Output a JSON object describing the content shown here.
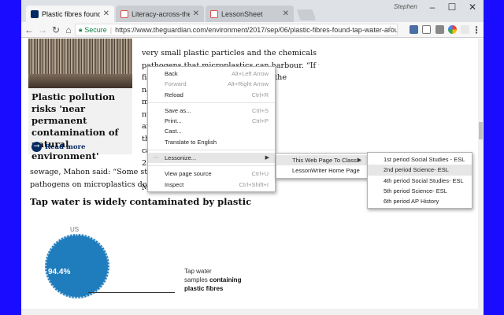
{
  "tabs": [
    {
      "label": "Plastic fibres found in tap",
      "active": true,
      "favicon_color": "#052962"
    },
    {
      "label": "Literacy-across-the-curric",
      "active": false,
      "favicon_color": "#d9534f"
    },
    {
      "label": "LessonSheet",
      "active": false,
      "favicon_color": "#d9534f"
    }
  ],
  "profile_name": "Stephen",
  "omnibox": {
    "secure_label": "Secure",
    "url": "https://www.theguardian.com/environment/2017/sep/06/plastic-fibres-found-tap-water-arou..."
  },
  "card": {
    "title": "Plastic pollution risks 'near permanent contamination of natural environment'",
    "read_more": "Read more"
  },
  "article_lines": [
    "very small plastic particles and the chemicals or",
    "pathogens that microplastics can harbour. “If the",
    "fibres are there, it is possible that the",
    "na                                                    n't",
    "m                                                   the",
    "nu                                                 trate a cell",
    "an                                                 ans, and",
    "th                                                lyses",
    "ca                                             ons in size,",
    "2",
    "",
    "M"
  ],
  "wide_lines": [
    "sewage, Mahon said: “Some studi",
    "pathogens on microplastics dowr                                                           ats.”"
  ],
  "subhead": "Tap water is widely contaminated by plastic",
  "chart": {
    "region": "US",
    "percent": "94.4%",
    "legend_line1": "Tap water",
    "legend_line2_pre": "samples ",
    "legend_line2_bold": "containing",
    "legend_line3": "plastic fibres"
  },
  "context_menu": {
    "items": [
      {
        "label": "Back",
        "shortcut": "Alt+Left Arrow",
        "disabled": false
      },
      {
        "label": "Forward",
        "shortcut": "Alt+Right Arrow",
        "disabled": true
      },
      {
        "label": "Reload",
        "shortcut": "Ctrl+R",
        "disabled": false
      },
      {
        "sep": true
      },
      {
        "label": "Save as...",
        "shortcut": "Ctrl+S",
        "disabled": false
      },
      {
        "label": "Print...",
        "shortcut": "Ctrl+P",
        "disabled": false
      },
      {
        "label": "Cast...",
        "shortcut": "",
        "disabled": false
      },
      {
        "label": "Translate to English",
        "shortcut": "",
        "disabled": false
      },
      {
        "sep": true
      },
      {
        "label": "Lessonize...",
        "shortcut": "",
        "disabled": false,
        "submenu": true,
        "highlight": true
      },
      {
        "sep": true
      },
      {
        "label": "View page source",
        "shortcut": "Ctrl+U",
        "disabled": false
      },
      {
        "label": "Inspect",
        "shortcut": "Ctrl+Shift+I",
        "disabled": false
      }
    ]
  },
  "submenu1": [
    {
      "label": "This Web Page To Class...",
      "submenu": true,
      "highlight": true
    },
    {
      "label": "LessonWriter Home Page",
      "submenu": false,
      "highlight": false
    }
  ],
  "submenu2": [
    {
      "label": "1st period Social Studies - ESL",
      "highlight": false
    },
    {
      "label": "2nd period Science- ESL",
      "highlight": true
    },
    {
      "label": "4th period Social Studies- ESL",
      "highlight": false
    },
    {
      "label": "5th period Science- ESL",
      "highlight": false
    },
    {
      "label": "6th period AP History",
      "highlight": false
    }
  ],
  "colors": {
    "accent": "#052962",
    "secure": "#0b8043",
    "donut": "#1f7dbd",
    "background": "#1a0dff"
  }
}
